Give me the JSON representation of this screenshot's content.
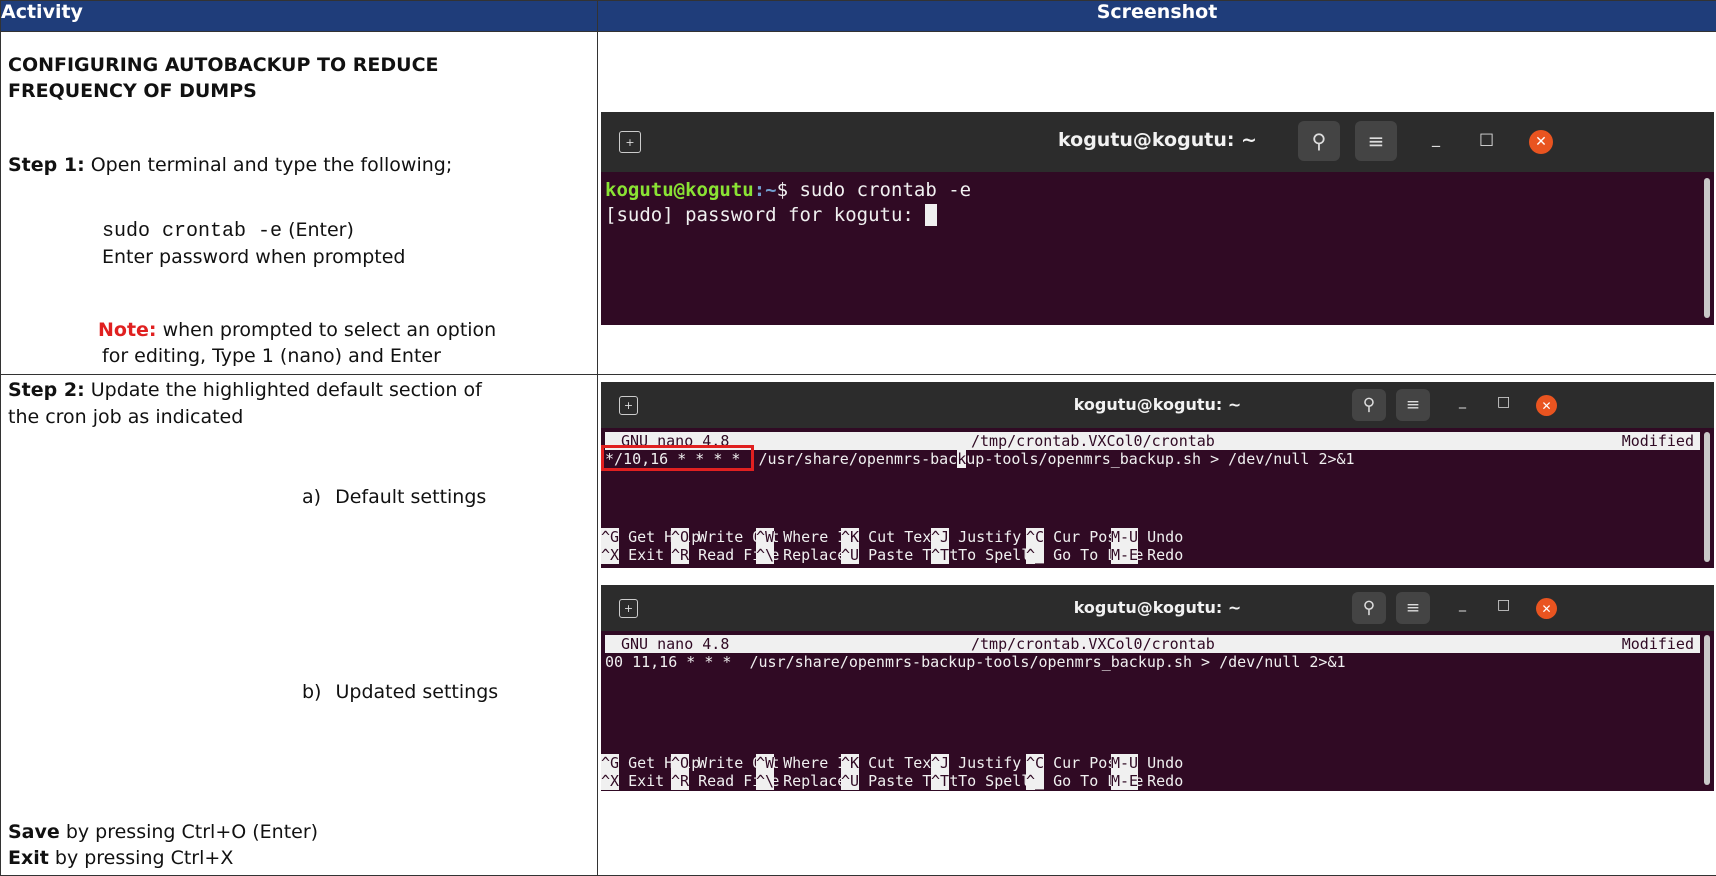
{
  "headers": {
    "activity": "Activity",
    "screenshot": "Screenshot"
  },
  "row1": {
    "title_line1": "CONFIGURING AUTOBACKUP TO REDUCE",
    "title_line2": "FREQUENCY OF DUMPS",
    "step1_label": "Step 1:",
    "step1_text": " Open terminal and type the following;",
    "command": "sudo crontab -e",
    "command_suffix": " (Enter)",
    "password_text": "Enter password when prompted",
    "note_label": "Note:",
    "note_line1": " when prompted to select an option",
    "note_line2": "for editing, Type 1 (nano) and Enter"
  },
  "row2": {
    "step2_label": "Step 2:",
    "step2_line1": " Update the highlighted default section of",
    "step2_line2": "the cron job as indicated",
    "item_a_marker": "a)",
    "item_a_text": "Default settings",
    "item_b_marker": "b)",
    "item_b_text": "Updated settings",
    "save_label": "Save",
    "save_text": " by pressing Ctrl+O (Enter)",
    "exit_label": "Exit",
    "exit_text": " by pressing Ctrl+X"
  },
  "terminal1": {
    "title": "kogutu@kogutu: ~",
    "prompt_user": "kogutu@kogutu",
    "prompt_path": ":~",
    "prompt_cmd": "$ sudo crontab -e",
    "line2": "[sudo] password for kogutu: "
  },
  "terminal2": {
    "title": "kogutu@kogutu: ~",
    "nano_version": "GNU nano 4.8",
    "file_path": "/tmp/crontab.VXCol0/crontab",
    "status": "Modified",
    "cron_schedule": "*/10,16 * * * *",
    "cron_cmd_a": "  /usr/share/openmrs-bac",
    "cron_cmd_cursor": "k",
    "cron_cmd_b": "up-tools/openmrs_backup.sh > /dev/null 2>&1"
  },
  "terminal3": {
    "title": "kogutu@kogutu: ~",
    "nano_version": "GNU nano 4.8",
    "file_path": "/tmp/crontab.VXCol0/crontab",
    "status": "Modified",
    "cron_line": "00 11,16 * * *  /usr/share/openmrs-backup-tools/openmrs_backup.sh > /dev/null 2>&1"
  },
  "nano_shortcuts": {
    "row1": [
      {
        "key": "^G",
        "label": " Get Help"
      },
      {
        "key": "^O",
        "label": " Write Out"
      },
      {
        "key": "^W",
        "label": " Where Is"
      },
      {
        "key": "^K",
        "label": " Cut Text"
      },
      {
        "key": "^J",
        "label": " Justify"
      },
      {
        "key": "^C",
        "label": " Cur Pos"
      },
      {
        "key": "M-U",
        "label": " Undo"
      }
    ],
    "row2": [
      {
        "key": "^X",
        "label": " Exit"
      },
      {
        "key": "^R",
        "label": " Read File"
      },
      {
        "key": "^\\",
        "label": " Replace"
      },
      {
        "key": "^U",
        "label": " Paste Text"
      },
      {
        "key": "^T",
        "label": " To Spell"
      },
      {
        "key": "^_",
        "label": " Go To Line"
      },
      {
        "key": "M-E",
        "label": " Redo"
      }
    ]
  },
  "icons": {
    "new_tab": "new-tab-icon",
    "search": "search-icon",
    "menu": "hamburger-menu-icon",
    "minimize": "minimize-icon",
    "maximize": "maximize-icon",
    "close": "close-icon"
  },
  "colors": {
    "header_bg": "#1f3d7a",
    "terminal_bg": "#300a24",
    "titlebar_bg": "#2c2c2c",
    "prompt_green": "#8ae234",
    "prompt_blue": "#729fcf",
    "close_orange": "#e95420",
    "note_red": "#e02020"
  }
}
